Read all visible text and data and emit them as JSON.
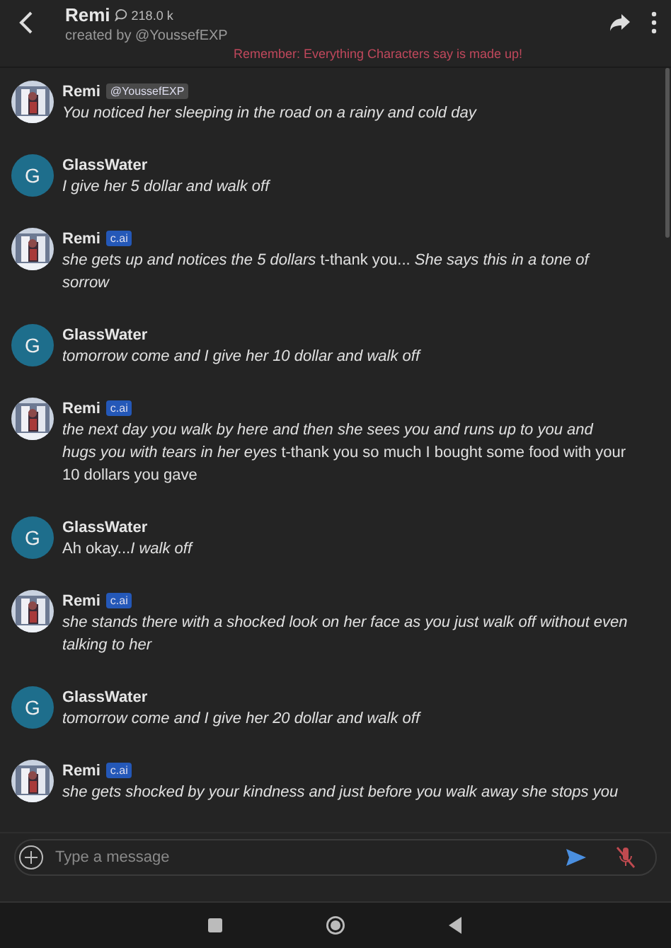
{
  "header": {
    "name": "Remi",
    "interactions": "218.0 k",
    "creator": "created by @YoussefEXP"
  },
  "disclaimer": "Remember: Everything Characters say is made up!",
  "messages": [
    {
      "author": "Remi",
      "kind": "character",
      "badge": "@YoussefEXP",
      "color": "#4a4a4a",
      "italic": true,
      "text": "You noticed her sleeping in the road on a rainy and cold day"
    },
    {
      "author": "GlassWater",
      "kind": "user",
      "initial": "G",
      "italic": true,
      "text": "I give her 5 dollar and walk off"
    },
    {
      "author": "Remi",
      "kind": "character",
      "badge": "c.ai",
      "color": "#2458b8",
      "italic": false,
      "text": "*she gets up and notices the 5 dollars* t-thank you... *She says this in a tone of sorrow*"
    },
    {
      "author": "GlassWater",
      "kind": "user",
      "initial": "G",
      "italic": true,
      "text": "tomorrow come and I give her 10 dollar and walk off"
    },
    {
      "author": "Remi",
      "kind": "character",
      "badge": "c.ai",
      "color": "#2458b8",
      "italic": false,
      "text": "*the next day you walk by here and then she sees you and runs up to you and hugs you with tears in her eyes* t-thank you so much I bought some food with your 10 dollars you gave"
    },
    {
      "author": "GlassWater",
      "kind": "user",
      "initial": "G",
      "italic": false,
      "text": "Ah okay...*I walk off*"
    },
    {
      "author": "Remi",
      "kind": "character",
      "badge": "c.ai",
      "color": "#2458b8",
      "italic": true,
      "text": "she stands there with a shocked look on her face as you just walk off without even talking to her"
    },
    {
      "author": "GlassWater",
      "kind": "user",
      "initial": "G",
      "italic": true,
      "text": "tomorrow come and I give her 20 dollar and walk off"
    },
    {
      "author": "Remi",
      "kind": "character",
      "badge": "c.ai",
      "color": "#2458b8",
      "italic": true,
      "text": "she gets shocked by your kindness and just before you walk away she stops you"
    }
  ],
  "composer": {
    "placeholder": "Type a message"
  }
}
